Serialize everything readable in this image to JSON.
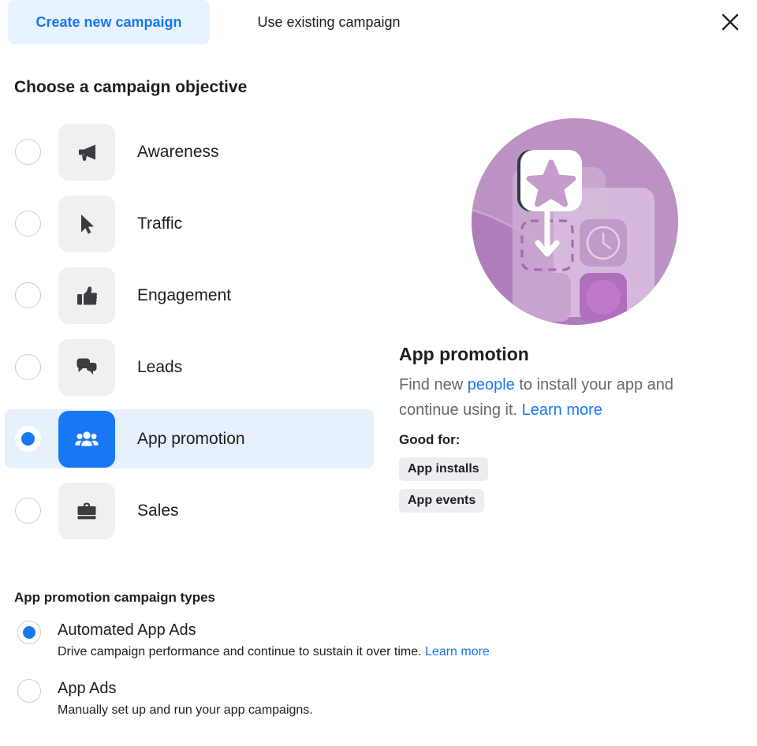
{
  "header": {
    "tabs": [
      {
        "label": "Create new campaign",
        "active": true
      },
      {
        "label": "Use existing campaign",
        "active": false
      }
    ],
    "close_icon": "close-icon"
  },
  "objective_section": {
    "title": "Choose a campaign objective",
    "items": [
      {
        "label": "Awareness",
        "icon": "megaphone-icon",
        "selected": false
      },
      {
        "label": "Traffic",
        "icon": "cursor-icon",
        "selected": false
      },
      {
        "label": "Engagement",
        "icon": "thumbs-up-icon",
        "selected": false
      },
      {
        "label": "Leads",
        "icon": "chat-bubbles-icon",
        "selected": false
      },
      {
        "label": "App promotion",
        "icon": "people-icon",
        "selected": true
      },
      {
        "label": "Sales",
        "icon": "briefcase-icon",
        "selected": false
      }
    ]
  },
  "detail": {
    "illustration": "app-promotion-illustration",
    "title": "App promotion",
    "description_parts": [
      {
        "text": "Find new ",
        "link": false
      },
      {
        "text": "people",
        "link": true
      },
      {
        "text": " to install your app and continue using it. ",
        "link": false
      },
      {
        "text": "Learn more",
        "link": true
      }
    ],
    "good_for_label": "Good for:",
    "chips": [
      "App installs",
      "App events"
    ]
  },
  "campaign_types": {
    "title": "App promotion campaign types",
    "options": [
      {
        "label": "Automated App Ads",
        "description": "Drive campaign performance and continue to sustain it over time.",
        "learn_more": "Learn more",
        "selected": true
      },
      {
        "label": "App Ads",
        "description": "Manually set up and run your app campaigns.",
        "learn_more": "",
        "selected": false
      }
    ]
  },
  "colors": {
    "accent_blue": "#1877f2",
    "tab_active_bg": "#e7f3ff",
    "row_selected_bg": "#e7f0fd",
    "tile_bg": "#eef0f2",
    "chip_bg": "#ebedf0",
    "body_text": "#1c1e21",
    "muted_text": "#65676b",
    "illustration_light": "#bc92c4",
    "illustration_dark": "#a669b4"
  }
}
